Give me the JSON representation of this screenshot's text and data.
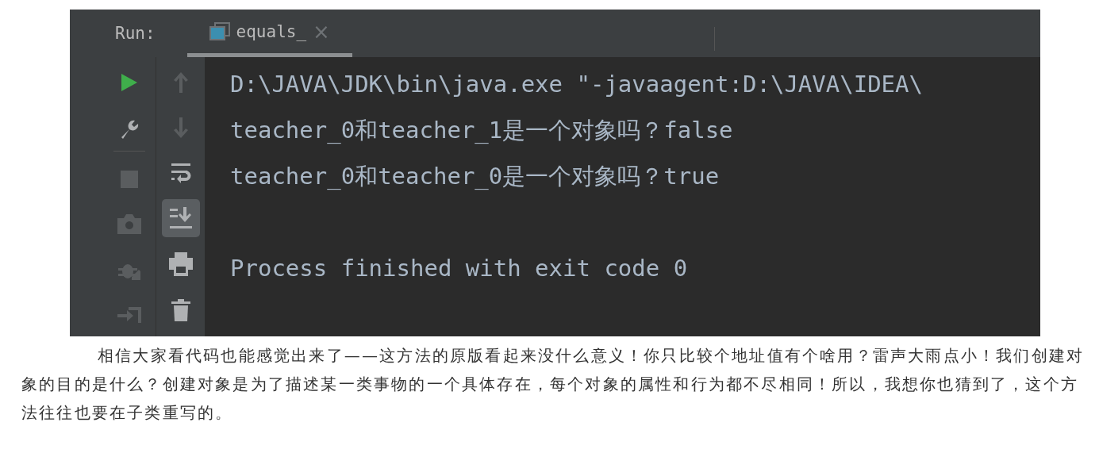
{
  "run_panel": {
    "label": "Run:",
    "tabs": [
      {
        "label": "equals_",
        "close": "×",
        "selected": true
      }
    ],
    "left_toolbar": [
      {
        "disabled": false
      },
      {
        "disabled": false
      },
      {
        "disabled": true
      },
      {
        "disabled": true
      },
      {
        "disabled": true
      },
      {
        "disabled": true
      }
    ],
    "right_toolbar": [
      {
        "disabled": true,
        "selected": false
      },
      {
        "disabled": true,
        "selected": false
      },
      {
        "disabled": false,
        "selected": false
      },
      {
        "disabled": false,
        "selected": true
      },
      {
        "disabled": false,
        "selected": false
      },
      {
        "disabled": false,
        "selected": false
      }
    ],
    "console": [
      "D:\\JAVA\\JDK\\bin\\java.exe \"-javaagent:D:\\JAVA\\IDEA\\",
      "teacher_0和teacher_1是一个对象吗？false",
      "teacher_0和teacher_0是一个对象吗？true"
    ],
    "exit_message": "Process finished with exit code 0"
  },
  "paragraph": "相信大家看代码也能感觉出来了——这方法的原版看起来没什么意义！你只比较个地址值有个啥用？雷声大雨点小！我们创建对象的目的是什么？创建对象是为了描述某一类事物的一个具体存在，每个对象的属性和行为都不尽相同！所以，我想你也猜到了，这个方法往往也要在子类重写的。"
}
